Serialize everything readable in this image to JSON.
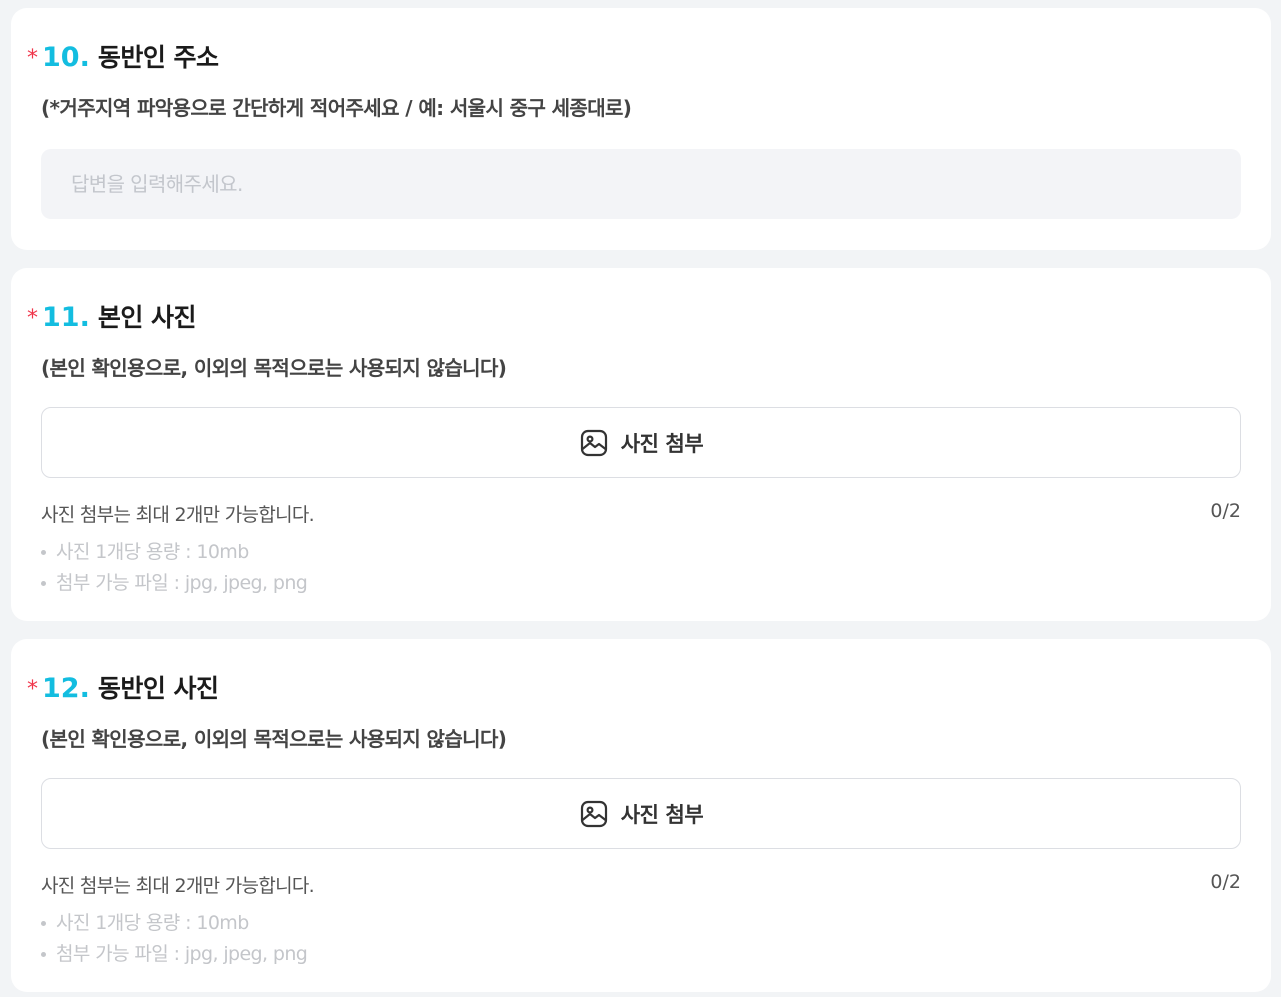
{
  "colors": {
    "required": "#f0364b",
    "question_number": "#13bde0",
    "page_background": "#f2f4f6"
  },
  "questions": [
    {
      "required_mark": "*",
      "number": "10.",
      "title": "동반인 주소",
      "description": "(*거주지역 파악용으로 간단하게 적어주세요 / 예: 서울시 중구 세종대로)",
      "answer_value": "",
      "answer_placeholder": "답변을 입력해주세요."
    },
    {
      "required_mark": "*",
      "number": "11.",
      "title": "본인 사진",
      "description": "(본인 확인용으로, 이외의 목적으로는 사용되지 않습니다)",
      "attach_icon": "image-icon",
      "attach_label": "사진 첨부",
      "limit_note": "사진 첨부는 최대 2개만 가능합니다.",
      "counter": "0/2",
      "notes": [
        "사진 1개당 용량 : 10mb",
        "첨부 가능 파일 : jpg, jpeg, png"
      ]
    },
    {
      "required_mark": "*",
      "number": "12.",
      "title": "동반인 사진",
      "description": "(본인 확인용으로, 이외의 목적으로는 사용되지 않습니다)",
      "attach_icon": "image-icon",
      "attach_label": "사진 첨부",
      "limit_note": "사진 첨부는 최대 2개만 가능합니다.",
      "counter": "0/2",
      "notes": [
        "사진 1개당 용량 : 10mb",
        "첨부 가능 파일 : jpg, jpeg, png"
      ]
    }
  ]
}
